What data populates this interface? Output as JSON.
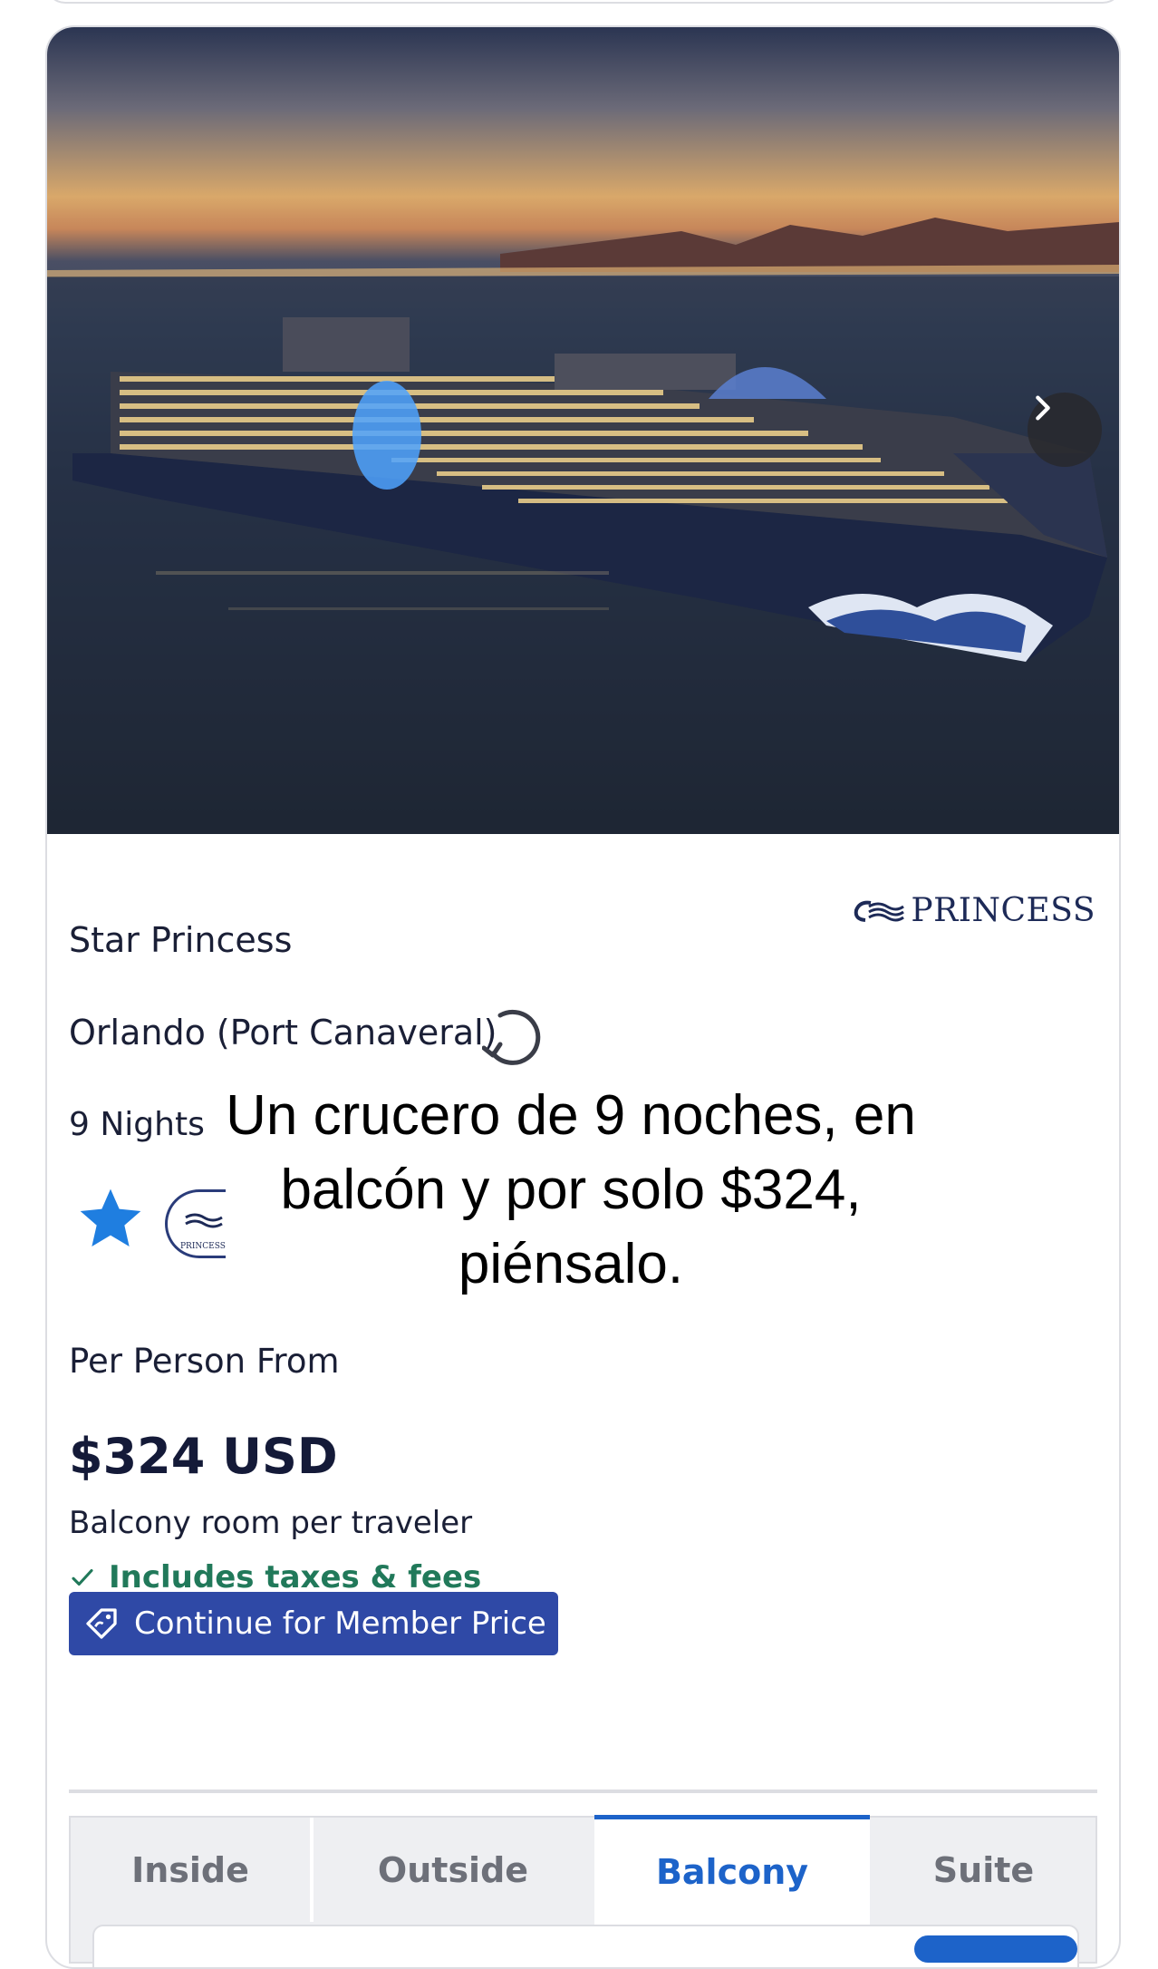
{
  "cruise": {
    "ship_name": "Star Princess",
    "brand": "PRINCESS",
    "port": "Orlando (Port Canaveral)",
    "nights_label": "9 Nights",
    "per_person_label": "Per Person From",
    "price": "$324 USD",
    "room_note": "Balcony room per traveler",
    "includes_label": "Includes taxes & fees",
    "cta_label": "Continue for Member Price",
    "mini_logo_text": "PRINCESS"
  },
  "overlay_caption": {
    "line1": "Un crucero de 9 noches, en",
    "line2": "balcón y por solo $324,",
    "line3": "piénsalo."
  },
  "tabs": [
    {
      "label": "Inside",
      "active": false
    },
    {
      "label": "Outside",
      "active": false
    },
    {
      "label": "Balcony",
      "active": true
    },
    {
      "label": "Suite",
      "active": false
    }
  ],
  "colors": {
    "accent_blue": "#1d63c9",
    "cta_blue": "#2f49a6",
    "success_green": "#21795a",
    "star_blue": "#1f7ee0",
    "brand_navy": "#1d2a57"
  },
  "icons": {
    "carousel_next": "chevron-right-icon",
    "member_tag": "tag-icon",
    "check": "check-icon",
    "rating": "star-icon",
    "refresh": "refresh-icon"
  }
}
